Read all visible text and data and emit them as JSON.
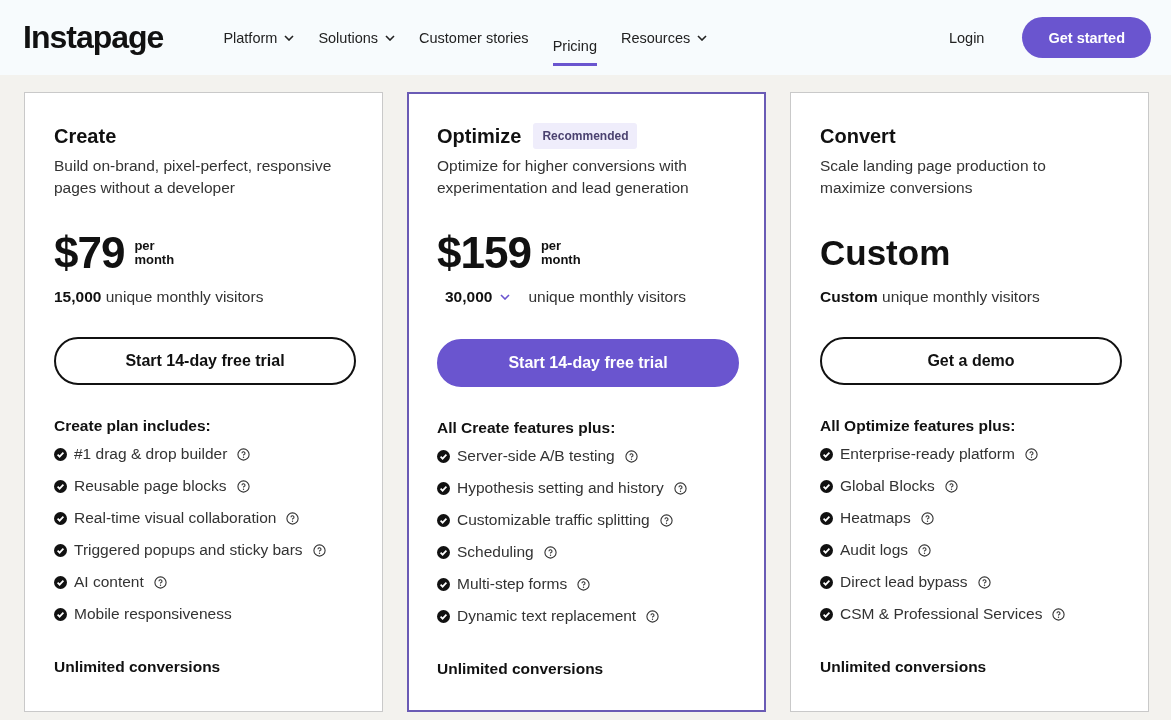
{
  "header": {
    "logo": "Instapage",
    "nav": [
      {
        "label": "Platform",
        "has_menu": true,
        "selected": false
      },
      {
        "label": "Solutions",
        "has_menu": true,
        "selected": false
      },
      {
        "label": "Customer stories",
        "has_menu": false,
        "selected": false
      },
      {
        "label": "Pricing",
        "has_menu": false,
        "selected": true
      },
      {
        "label": "Resources",
        "has_menu": true,
        "selected": false
      }
    ],
    "login": "Login",
    "cta": "Get started"
  },
  "plans": [
    {
      "name": "Create",
      "recommended": false,
      "description": "Build on-brand, pixel-perfect, responsive pages without a developer",
      "kind": "amount",
      "price": "$79",
      "period": [
        "per",
        "month"
      ],
      "visitors": {
        "value": "15,000",
        "dropdown": false,
        "text": "unique monthly visitors"
      },
      "button": {
        "label": "Start 14-day free trial",
        "kind": "outline"
      },
      "features_heading": "Create plan includes:",
      "features": [
        {
          "label": "#1 drag & drop builder",
          "help": true
        },
        {
          "label": "Reusable page blocks",
          "help": true
        },
        {
          "label": "Real-time visual collaboration",
          "help": true
        },
        {
          "label": "Triggered popups and sticky bars",
          "help": true
        },
        {
          "label": "AI content",
          "help": true
        },
        {
          "label": "Mobile responsiveness",
          "help": false
        }
      ],
      "footer": "Unlimited conversions"
    },
    {
      "name": "Optimize",
      "recommended": true,
      "badge": "Recommended",
      "description": "Optimize for higher conversions with experimentation and lead generation",
      "kind": "amount",
      "price": "$159",
      "period": [
        "per",
        "month"
      ],
      "visitors": {
        "value": "30,000",
        "dropdown": true,
        "text": "unique monthly visitors"
      },
      "button": {
        "label": "Start 14-day free trial",
        "kind": "filled"
      },
      "features_heading": "All Create features plus:",
      "features": [
        {
          "label": "Server-side A/B testing",
          "help": true
        },
        {
          "label": "Hypothesis setting and history",
          "help": true
        },
        {
          "label": "Customizable traffic splitting",
          "help": true
        },
        {
          "label": "Scheduling",
          "help": true
        },
        {
          "label": "Multi-step forms",
          "help": true
        },
        {
          "label": "Dynamic text replacement",
          "help": true
        }
      ],
      "footer": "Unlimited conversions"
    },
    {
      "name": "Convert",
      "recommended": false,
      "description": "Scale landing page production to maximize conversions",
      "kind": "custom",
      "price": "Custom",
      "visitors": {
        "value": "Custom",
        "dropdown": false,
        "text": "unique monthly visitors"
      },
      "button": {
        "label": "Get a demo",
        "kind": "outline"
      },
      "features_heading": "All Optimize features plus:",
      "features": [
        {
          "label": "Enterprise-ready platform",
          "help": true
        },
        {
          "label": "Global Blocks",
          "help": true
        },
        {
          "label": "Heatmaps",
          "help": true
        },
        {
          "label": "Audit logs",
          "help": true
        },
        {
          "label": "Direct lead bypass",
          "help": true
        },
        {
          "label": "CSM & Professional Services",
          "help": true
        }
      ],
      "footer": "Unlimited conversions"
    }
  ]
}
